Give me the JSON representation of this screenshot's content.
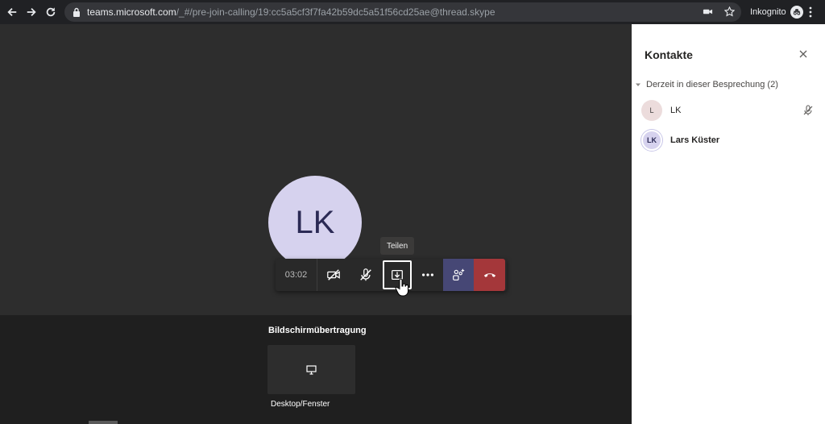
{
  "browser": {
    "url_host": "teams.microsoft.com",
    "url_path": "/_#/pre-join-calling/19:cc5a5cf3f7fa42b59dc5a51f56cd25ae@thread.skype",
    "incognito_label": "Inkognito"
  },
  "meeting": {
    "avatar_initials": "LK",
    "tooltip": "Teilen",
    "timer": "03:02",
    "share_title": "Bildschirmübertragung",
    "share_option": "Desktop/Fenster"
  },
  "panel": {
    "title": "Kontakte",
    "section_label": "Derzeit in dieser Besprechung (2)",
    "members": [
      {
        "initials": "L",
        "name": "LK"
      },
      {
        "initials": "LK",
        "name": "Lars Küster"
      }
    ]
  },
  "colors": {
    "accent": "#464775",
    "hangup": "#a4373a",
    "avatar_bg": "#d6d2ee"
  }
}
